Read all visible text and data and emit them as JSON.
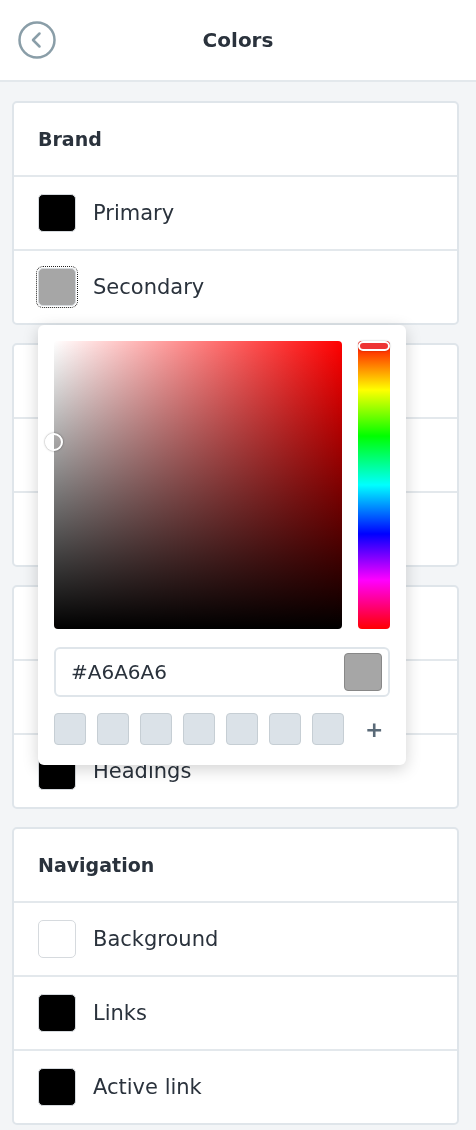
{
  "header": {
    "title": "Colors"
  },
  "sections": [
    {
      "title": "Brand",
      "items": [
        {
          "kind": "swatch",
          "label": "Primary",
          "color": "#000000",
          "selected": false
        },
        {
          "kind": "swatch",
          "label": "Secondary",
          "color": "#a6a6a6",
          "selected": true
        }
      ]
    },
    {
      "items": [
        {
          "kind": "hidden"
        },
        {
          "kind": "hidden"
        }
      ]
    },
    {
      "items": [
        {
          "kind": "hidden"
        },
        {
          "kind": "swatch",
          "label": "Headings",
          "color": "#000000",
          "selected": false
        }
      ]
    },
    {
      "title": "Navigation",
      "items": [
        {
          "kind": "swatch",
          "label": "Background",
          "color": "#ffffff",
          "selected": false
        },
        {
          "kind": "swatch",
          "label": "Links",
          "color": "#000000",
          "selected": false
        },
        {
          "kind": "swatch",
          "label": "Active link",
          "color": "#000000",
          "selected": false
        }
      ]
    }
  ],
  "picker": {
    "hex": "#A6A6A6",
    "hue_slider": {
      "level": 0
    },
    "presets": [
      {
        "kind": "empty"
      },
      {
        "kind": "empty"
      },
      {
        "kind": "empty"
      },
      {
        "kind": "empty"
      },
      {
        "kind": "empty"
      },
      {
        "kind": "empty"
      },
      {
        "kind": "empty"
      }
    ],
    "add_label": "+"
  }
}
